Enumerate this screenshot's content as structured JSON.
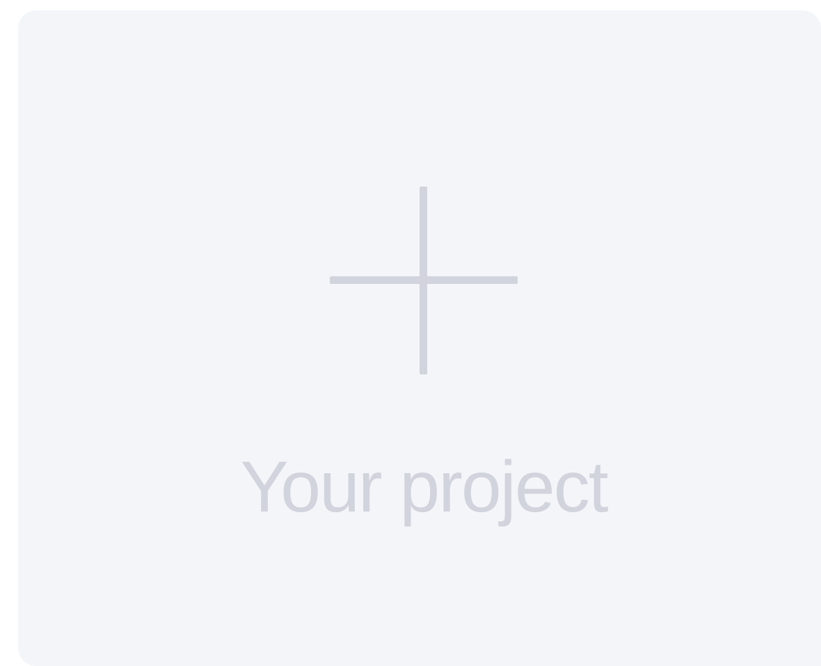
{
  "card": {
    "label": "Your project",
    "icon": "plus-icon"
  },
  "colors": {
    "page_background": "#ffffff",
    "card_background": "#f3f5f9",
    "placeholder_foreground": "#d1d4dc"
  }
}
